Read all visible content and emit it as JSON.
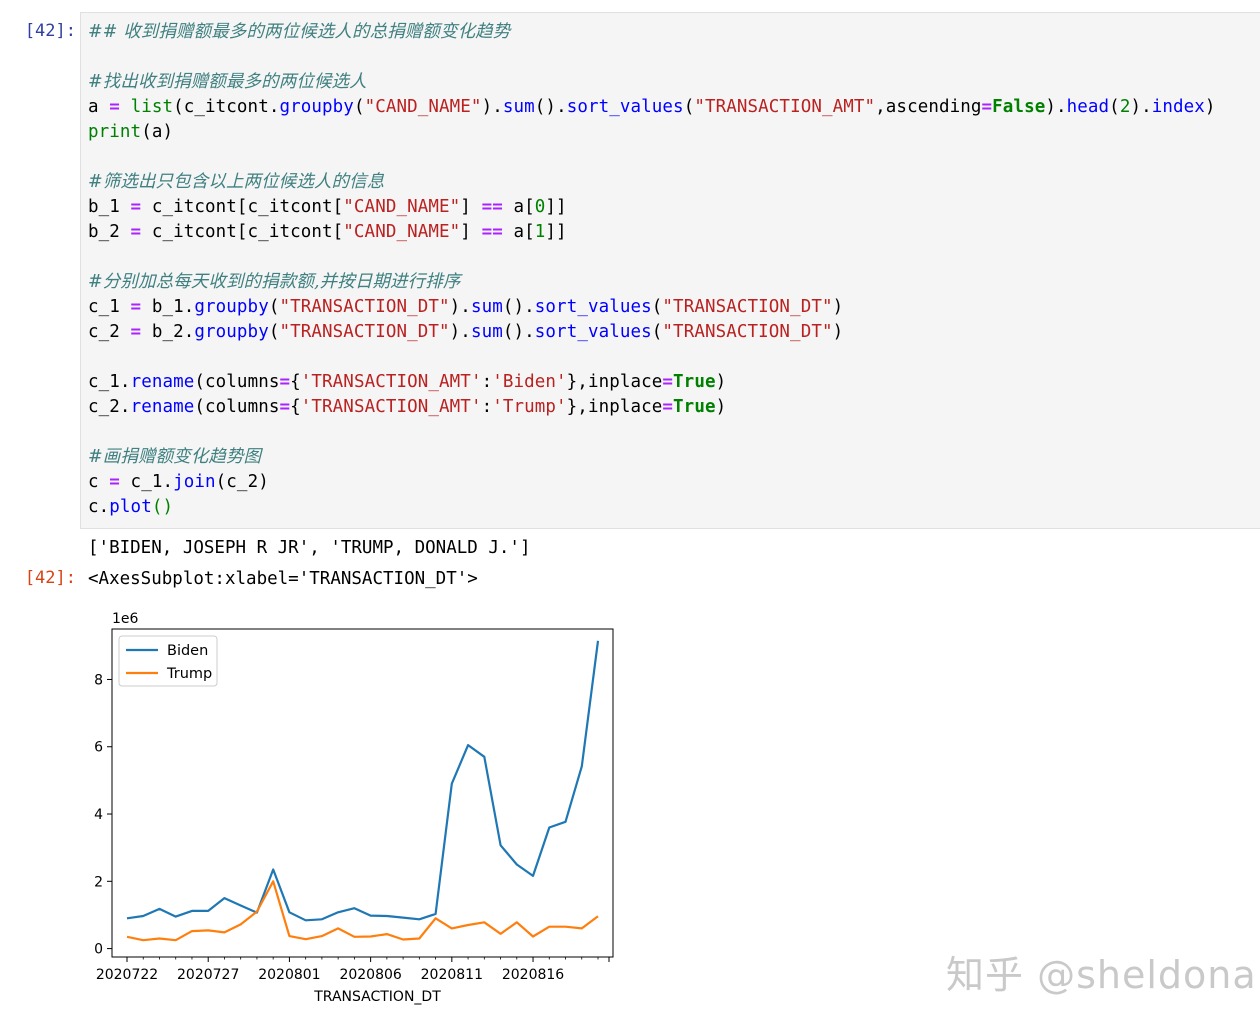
{
  "cells": {
    "in_prompt": "[42]:",
    "out_prompt": "[42]:",
    "code": {
      "l1": "## 收到捐赠额最多的两位候选人的总捐赠额变化趋势",
      "l2": "#找出收到捐赠额最多的两位候选人",
      "l3a": "a ",
      "l3b": "=",
      "l3c": " ",
      "l3d": "list",
      "l3e": "(c_itcont",
      "l3f": ".",
      "l3g": "groupby",
      "l3h": "(",
      "l3i": "\"CAND_NAME\"",
      "l3j": ")",
      "l3k": ".",
      "l3l": "sum",
      "l3m": "()",
      "l3n": ".",
      "l3o": "sort_values",
      "l3p": "(",
      "l3q": "\"TRANSACTION_AMT\"",
      "l3r": ",ascending",
      "l3s": "=",
      "l3t": "False",
      "l3u": ")",
      "l3v": ".",
      "l3w": "head",
      "l3x": "(",
      "l3y": "2",
      "l3z": ")",
      "l3aa": ".",
      "l3ab": "index",
      "l3ac": ")",
      "l4a": "print",
      "l4b": "(a)",
      "l5": "#筛选出只包含以上两位候选人的信息",
      "l6a": "b_1 ",
      "l6b": "=",
      "l6c": " c_itcont[c_itcont[",
      "l6d": "\"CAND_NAME\"",
      "l6e": "] ",
      "l6f": "==",
      "l6g": " a[",
      "l6h": "0",
      "l6i": "]]",
      "l7a": "b_2 ",
      "l7b": "=",
      "l7c": " c_itcont[c_itcont[",
      "l7d": "\"CAND_NAME\"",
      "l7e": "] ",
      "l7f": "==",
      "l7g": " a[",
      "l7h": "1",
      "l7i": "]]",
      "l8": "#分别加总每天收到的捐款额,并按日期进行排序",
      "l9a": "c_1 ",
      "l9b": "=",
      "l9c": " b_1",
      "l9d": ".",
      "l9e": "groupby",
      "l9f": "(",
      "l9g": "\"TRANSACTION_DT\"",
      "l9h": ")",
      "l9i": ".",
      "l9j": "sum",
      "l9k": "()",
      "l9l": ".",
      "l9m": "sort_values",
      "l9n": "(",
      "l9o": "\"TRANSACTION_DT\"",
      "l9p": ")",
      "l10a": "c_2 ",
      "l10b": "=",
      "l10c": " b_2",
      "l10d": ".",
      "l10e": "groupby",
      "l10f": "(",
      "l10g": "\"TRANSACTION_DT\"",
      "l10h": ")",
      "l10i": ".",
      "l10j": "sum",
      "l10k": "()",
      "l10l": ".",
      "l10m": "sort_values",
      "l10n": "(",
      "l10o": "\"TRANSACTION_DT\"",
      "l10p": ")",
      "l11a": "c_1",
      "l11b": ".",
      "l11c": "rename",
      "l11d": "(columns",
      "l11e": "=",
      "l11f": "{",
      "l11g": "'TRANSACTION_AMT'",
      "l11h": ":",
      "l11i": "'Biden'",
      "l11j": "},inplace",
      "l11k": "=",
      "l11l": "True",
      "l11m": ")",
      "l12a": "c_2",
      "l12b": ".",
      "l12c": "rename",
      "l12d": "(columns",
      "l12e": "=",
      "l12f": "{",
      "l12g": "'TRANSACTION_AMT'",
      "l12h": ":",
      "l12i": "'Trump'",
      "l12j": "},inplace",
      "l12k": "=",
      "l12l": "True",
      "l12m": ")",
      "l13": "#画捐赠额变化趋势图",
      "l14a": "c ",
      "l14b": "=",
      "l14c": " c_1",
      "l14d": ".",
      "l14e": "join",
      "l14f": "(c_2)",
      "l15a": "c",
      "l15b": ".",
      "l15c": "plot",
      "l15d": "()"
    },
    "stdout": "['BIDEN, JOSEPH R JR', 'TRUMP, DONALD J.']",
    "result": "<AxesSubplot:xlabel='TRANSACTION_DT'>"
  },
  "chart_data": {
    "type": "line",
    "xlabel": "TRANSACTION_DT",
    "ylabel": "",
    "offset_label": "1e6",
    "x_tick_labels": [
      "2020722",
      "2020727",
      "2020801",
      "2020806",
      "2020811",
      "2020816"
    ],
    "x": [
      "2020722",
      "2020723",
      "2020724",
      "2020725",
      "2020726",
      "2020727",
      "2020728",
      "2020729",
      "2020730",
      "2020731",
      "2020801",
      "2020802",
      "2020803",
      "2020804",
      "2020805",
      "2020806",
      "2020807",
      "2020808",
      "2020809",
      "2020810",
      "2020811",
      "2020812",
      "2020813",
      "2020814",
      "2020815",
      "2020816",
      "2020817",
      "2020818",
      "2020819",
      "2020820"
    ],
    "ylim": [
      -0.25,
      9.5
    ],
    "y_ticks": [
      0,
      2,
      4,
      6,
      8
    ],
    "legend_position": "top-left",
    "grid": false,
    "series": [
      {
        "name": "Biden",
        "color": "#1f77b4",
        "values": [
          0.9,
          0.97,
          1.18,
          0.95,
          1.12,
          1.12,
          1.5,
          1.28,
          1.07,
          2.35,
          1.08,
          0.84,
          0.87,
          1.08,
          1.2,
          0.98,
          0.97,
          0.92,
          0.87,
          1.03,
          4.9,
          6.05,
          5.7,
          3.07,
          2.5,
          2.16,
          3.6,
          3.77,
          5.42,
          9.15
        ]
      },
      {
        "name": "Trump",
        "color": "#ff7f0e",
        "values": [
          0.35,
          0.25,
          0.3,
          0.25,
          0.52,
          0.54,
          0.48,
          0.72,
          1.1,
          2.0,
          0.37,
          0.28,
          0.37,
          0.6,
          0.35,
          0.36,
          0.43,
          0.27,
          0.3,
          0.9,
          0.6,
          0.7,
          0.78,
          0.44,
          0.78,
          0.36,
          0.65,
          0.65,
          0.6,
          0.96
        ]
      }
    ]
  },
  "watermark": "知乎 @sheldona"
}
